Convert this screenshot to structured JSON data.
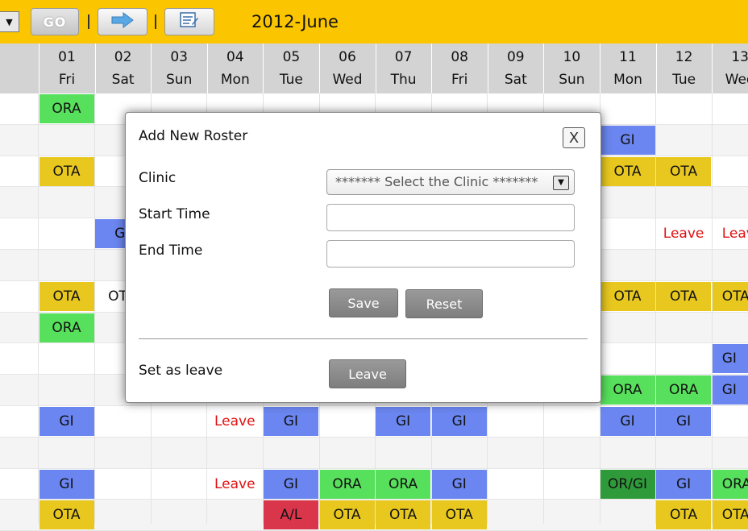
{
  "toolbar": {
    "select_arrow": "▼",
    "go_label": "GO",
    "next_icon": "right-arrow-icon",
    "calendar_icon": "calendar-edit-icon",
    "month_title": "2012-June",
    "colors": {
      "bar": "#fbc600"
    }
  },
  "calendar": {
    "days": [
      {
        "date": "01",
        "weekday": "Fri"
      },
      {
        "date": "02",
        "weekday": "Sat"
      },
      {
        "date": "03",
        "weekday": "Sun"
      },
      {
        "date": "04",
        "weekday": "Mon"
      },
      {
        "date": "05",
        "weekday": "Tue"
      },
      {
        "date": "06",
        "weekday": "Wed"
      },
      {
        "date": "07",
        "weekday": "Thu"
      },
      {
        "date": "08",
        "weekday": "Fri"
      },
      {
        "date": "09",
        "weekday": "Sat"
      },
      {
        "date": "10",
        "weekday": "Sun"
      },
      {
        "date": "11",
        "weekday": "Mon"
      },
      {
        "date": "12",
        "weekday": "Tue"
      },
      {
        "date": "13",
        "weekday": "Wed"
      }
    ],
    "rows": [
      [
        "ORA",
        "",
        "",
        "",
        "",
        "",
        "",
        "",
        "",
        "",
        "",
        "",
        ""
      ],
      [
        "",
        "",
        "",
        "",
        "",
        "",
        "",
        "",
        "",
        "",
        "GI",
        "",
        ""
      ],
      [
        "OTA",
        "",
        "",
        "",
        "",
        "",
        "",
        "",
        "",
        "",
        "OTA",
        "OTA",
        ""
      ],
      [
        "",
        "",
        "",
        "",
        "",
        "",
        "",
        "",
        "",
        "",
        "",
        "",
        ""
      ],
      [
        "",
        "G",
        "",
        "",
        "",
        "",
        "",
        "",
        "",
        "",
        "",
        "Leave",
        "Leave"
      ],
      [
        "",
        "",
        "",
        "",
        "",
        "",
        "",
        "",
        "",
        "",
        "",
        "",
        ""
      ],
      [
        "OTA",
        "OT",
        "",
        "",
        "",
        "",
        "",
        "",
        "",
        "",
        "OTA",
        "OTA",
        "OTA"
      ],
      [
        "ORA",
        "",
        "",
        "",
        "",
        "",
        "",
        "",
        "",
        "",
        "",
        "",
        ""
      ],
      [
        "",
        "",
        "",
        "",
        "",
        "",
        "",
        "",
        "",
        "",
        "",
        "",
        "GI"
      ],
      [
        "",
        "",
        "",
        "",
        "",
        "",
        "",
        "",
        "",
        "",
        "ORA",
        "ORA",
        "GI"
      ],
      [
        "GI",
        "",
        "",
        "Leave",
        "GI",
        "",
        "GI",
        "GI",
        "",
        "",
        "GI",
        "GI",
        ""
      ],
      [
        "",
        "",
        "",
        "",
        "",
        "",
        "",
        "",
        "",
        "",
        "",
        "",
        ""
      ],
      [
        "GI",
        "",
        "",
        "Leave",
        "GI",
        "ORA",
        "ORA",
        "GI",
        "",
        "",
        "OR/GI",
        "GI",
        "ORA"
      ],
      [
        "OTA",
        "",
        "",
        "",
        "A/L",
        "OTA",
        "OTA",
        "OTA",
        "",
        "",
        "",
        "OTA",
        "OTA"
      ]
    ],
    "colors": {
      "ORA": "#57e05c",
      "OTA": "#e8c81f",
      "GI": "#6b86f0",
      "OR/GI": "#2e9a3a",
      "A/L": "#d9364c",
      "Leave": "#e01010"
    }
  },
  "dialog": {
    "title": "Add New Roster",
    "close_label": "X",
    "clinic_label": "Clinic",
    "clinic_selected": "******* Select the Clinic *******",
    "clinic_arrow": "▼",
    "start_label": "Start Time",
    "start_value": "",
    "end_label": "End Time",
    "end_value": "",
    "save_label": "Save",
    "reset_label": "Reset",
    "leave_section_label": "Set as leave",
    "leave_button_label": "Leave"
  }
}
